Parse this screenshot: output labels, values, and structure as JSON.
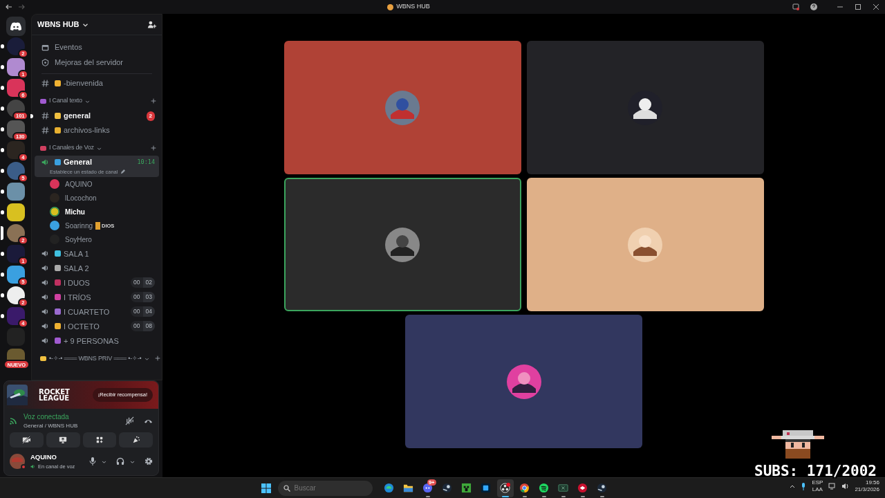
{
  "window": {
    "title": "WBNS HUB"
  },
  "servers": [
    {
      "badge": "2",
      "unread": true,
      "selected": false
    },
    {
      "badge": "1",
      "unread": true,
      "selected": false
    },
    {
      "badge": "6",
      "unread": true,
      "selected": false
    },
    {
      "badge": "101",
      "unread": true,
      "selected": false
    },
    {
      "badge": "130",
      "unread": true,
      "selected": false
    },
    {
      "badge": "4",
      "unread": true,
      "selected": false
    },
    {
      "badge": "5",
      "unread": true,
      "selected": false
    },
    {
      "unread": true,
      "selected": false
    },
    {
      "unread": true,
      "selected": false
    },
    {
      "badge": "2",
      "unread": false,
      "selected": true
    },
    {
      "badge": "1",
      "unread": true,
      "selected": false
    },
    {
      "badge": "5",
      "unread": true,
      "selected": false
    },
    {
      "badge": "2",
      "unread": true,
      "selected": false
    },
    {
      "badge": "4",
      "unread": true,
      "selected": false
    },
    {
      "unread": false,
      "selected": false
    },
    {
      "badge": "NUEVO",
      "unread": false,
      "selected": false
    }
  ],
  "server_header": {
    "name": "WBNS HUB"
  },
  "server_menu": [
    "Eventos",
    "Mejoras del servidor"
  ],
  "channels": [
    {
      "kind": "text",
      "name": "-bienvenida",
      "unread": false
    },
    {
      "kind": "category",
      "name": "I Canal texto",
      "children": [
        {
          "kind": "text",
          "name": "general",
          "unread": true,
          "badge": "2"
        },
        {
          "kind": "text",
          "name": "archivos-links",
          "unread": false
        }
      ]
    },
    {
      "kind": "category",
      "name": "I Canales de Voz",
      "children": [
        {
          "kind": "voice",
          "name": "General",
          "selected": true,
          "time": "10:14",
          "status": "Establece un estado de canal",
          "children": [
            {
              "name": "AQUINO",
              "speaking": false
            },
            {
              "name": "lLocochon",
              "speaking": false
            },
            {
              "name": "Michu",
              "speaking": true
            },
            {
              "name": "Soarinng",
              "speaking": false,
              "tag": "DIOS"
            },
            {
              "name": "SoyHero",
              "speaking": false
            }
          ]
        },
        {
          "kind": "voice",
          "name": "SALA 1",
          "selected": false
        },
        {
          "kind": "voice",
          "name": "SALA 2",
          "selected": false
        },
        {
          "kind": "voice",
          "name": "I  DUOS",
          "selected": false,
          "count": "00",
          "limit": "02"
        },
        {
          "kind": "voice",
          "name": "I TRÍOS",
          "selected": false,
          "count": "00",
          "limit": "03"
        },
        {
          "kind": "voice",
          "name": "I CUARTETO",
          "selected": false,
          "count": "00",
          "limit": "04"
        },
        {
          "kind": "voice",
          "name": "I  OCTETO",
          "selected": false,
          "count": "00",
          "limit": "08"
        },
        {
          "kind": "voice",
          "name": "+ 9 PERSONAS",
          "selected": false
        }
      ]
    },
    {
      "kind": "category",
      "name": "•-✧-• ═══ WBNS PRIV ═══ •-✧-•"
    }
  ],
  "promo": {
    "logo_lines": [
      "ROCKET",
      "LEAGUE"
    ],
    "button": "¡Recibir recompensa!"
  },
  "voice_panel": {
    "status": "Voz conectada",
    "location": "General / WBNS HUB"
  },
  "user_panel": {
    "name": "AQUINO",
    "status": "En canal de voz"
  },
  "video_tiles": [
    {
      "color": "#b04236",
      "speaking": false
    },
    {
      "color": "#232327",
      "speaking": false
    },
    {
      "color": "#2b2b2b",
      "speaking": true
    },
    {
      "color": "#dfb088",
      "speaking": false
    },
    {
      "color": "#32375f",
      "speaking": false
    }
  ],
  "taskbar": {
    "search_placeholder": "Buscar",
    "apps": [
      {
        "kind": "edge",
        "selected": false,
        "running": false
      },
      {
        "kind": "files",
        "selected": false,
        "running": false
      },
      {
        "kind": "discord",
        "selected": false,
        "running": true,
        "badge": "9+"
      },
      {
        "kind": "steam",
        "selected": false,
        "running": false
      },
      {
        "kind": "minecraft",
        "selected": false,
        "running": false
      },
      {
        "kind": "photoshop",
        "selected": false,
        "running": false
      },
      {
        "kind": "obs",
        "selected": true,
        "running": true
      },
      {
        "kind": "chrome",
        "selected": false,
        "running": true
      },
      {
        "kind": "spotify",
        "selected": false,
        "running": true
      },
      {
        "kind": "excel",
        "selected": false,
        "running": true
      },
      {
        "kind": "game",
        "selected": false,
        "running": true
      },
      {
        "kind": "steam",
        "selected": false,
        "running": true
      }
    ],
    "language": "ESP",
    "layout": "LAA",
    "time": "19:56",
    "date": "21/3/2026"
  },
  "stream_overlay": {
    "subs": "SUBS: 171/2002"
  }
}
